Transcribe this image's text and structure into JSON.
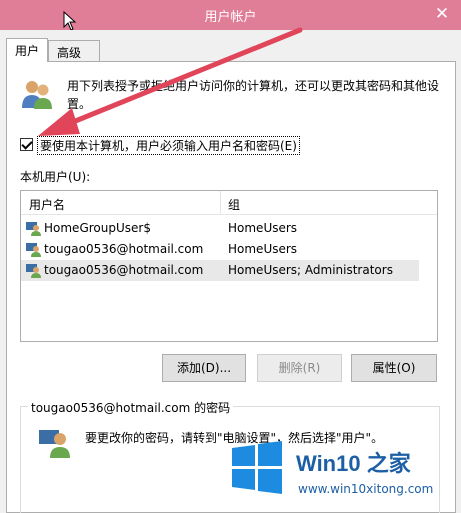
{
  "window": {
    "title": "用户帐户",
    "close_glyph": "✕"
  },
  "tabs": [
    {
      "label": "用户",
      "active": true
    },
    {
      "label": "高级",
      "active": false
    }
  ],
  "description": "用下列表授予或拒绝用户访问你的计算机，还可以更改其密码和其他设置。",
  "require_login": {
    "label": "要使用本计算机，用户必须输入用户名和密码(E)",
    "checked": true
  },
  "users_list": {
    "label": "本机用户(U):",
    "columns": [
      "用户名",
      "组"
    ],
    "rows": [
      {
        "name": "HomeGroupUser$",
        "group": "HomeUsers",
        "selected": false
      },
      {
        "name": "tougao0536@hotmail.com",
        "group": "HomeUsers",
        "selected": false
      },
      {
        "name": "tougao0536@hotmail.com",
        "group": "HomeUsers; Administrators",
        "selected": true
      }
    ]
  },
  "buttons": {
    "add": "添加(D)...",
    "remove": "删除(R)",
    "properties": "属性(O)"
  },
  "password_group": {
    "label": "tougao0536@hotmail.com 的密码",
    "text": "要更改你的密码，请转到\"电脑设置\"，然后选择\"用户\"。"
  },
  "watermark": {
    "title": "Win10 之家",
    "url": "www.win10xitong.com"
  },
  "colors": {
    "titlebar": "#e07d97",
    "arrow": "#e0455a",
    "brand": "#1d5fa5"
  }
}
